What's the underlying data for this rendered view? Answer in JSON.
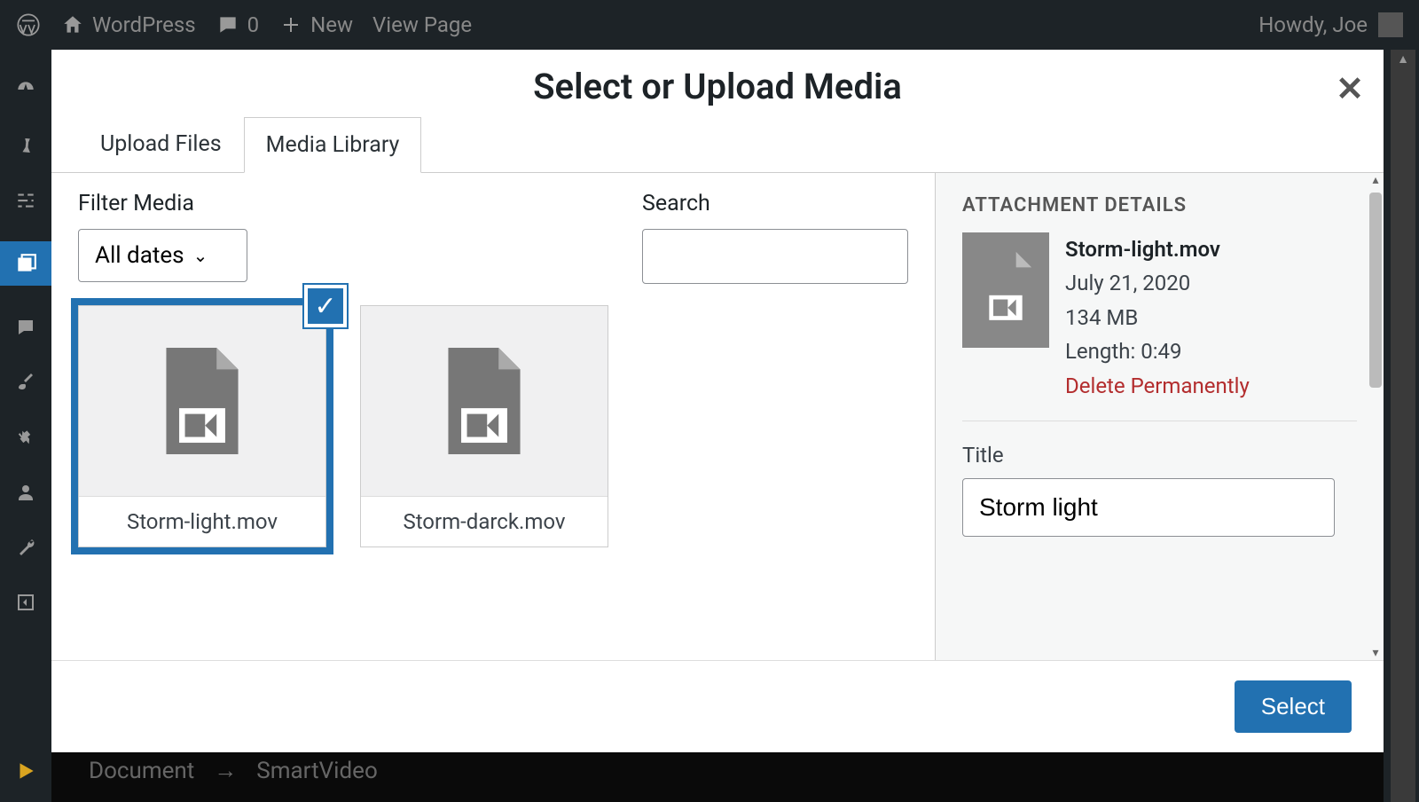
{
  "adminbar": {
    "site_name": "WordPress",
    "comments_count": "0",
    "new_label": "New",
    "view_page": "View Page",
    "howdy": "Howdy, Joe"
  },
  "modal": {
    "title": "Select or Upload Media",
    "tabs": {
      "upload": "Upload Files",
      "library": "Media Library"
    },
    "filter_label": "Filter Media",
    "filter_value": "All dates",
    "search_label": "Search",
    "media_items": [
      {
        "filename": "Storm-light.mov",
        "selected": true
      },
      {
        "filename": "Storm-darck.mov",
        "selected": false
      }
    ],
    "details": {
      "heading": "ATTACHMENT DETAILS",
      "filename": "Storm-light.mov",
      "date": "July 21, 2020",
      "size": "134 MB",
      "length": "Length: 0:49",
      "delete": "Delete Permanently",
      "title_label": "Title",
      "title_value": "Storm light"
    },
    "select_button": "Select"
  },
  "breadcrumb": {
    "root": "Document",
    "arrow": "→",
    "current": "SmartVideo"
  }
}
